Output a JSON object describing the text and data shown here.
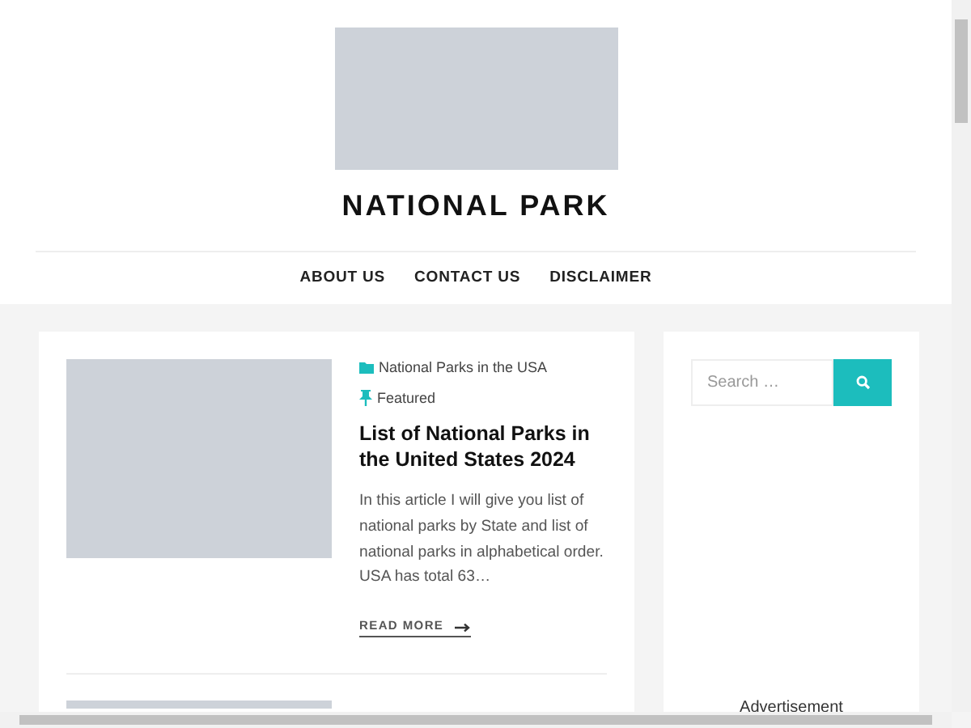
{
  "site": {
    "title": "NATIONAL PARK"
  },
  "nav": [
    {
      "label": "ABOUT US"
    },
    {
      "label": "CONTACT US"
    },
    {
      "label": "DISCLAIMER"
    }
  ],
  "posts": [
    {
      "category": "National Parks in the USA",
      "tag": "Featured",
      "title": "List of National Parks in the United States 2024",
      "excerpt": "In this article I will give you list of national parks by State and list of national parks in alphabetical order. USA has total 63…",
      "read_more": "READ MORE"
    },
    {
      "kind": "cut_off"
    }
  ],
  "sidebar": {
    "search": {
      "placeholder": "Search …"
    },
    "ad_label": "Advertisement"
  }
}
